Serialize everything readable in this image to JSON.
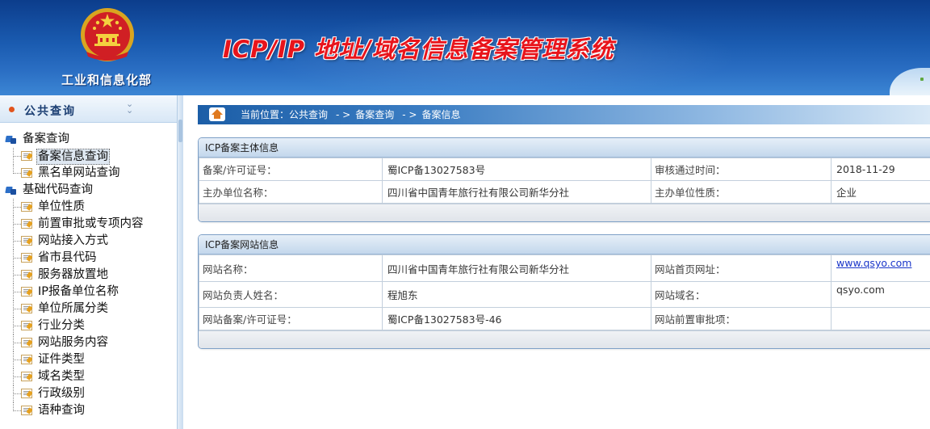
{
  "header": {
    "ministry": "工业和信息化部",
    "system_title": "ICP/IP 地址/域名信息备案管理系统"
  },
  "sidebar": {
    "title": "公共查询",
    "groups": [
      {
        "label": "备案查询",
        "items": [
          {
            "label": "备案信息查询",
            "selected": true
          },
          {
            "label": "黑名单网站查询"
          }
        ]
      },
      {
        "label": "基础代码查询",
        "items": [
          {
            "label": "单位性质"
          },
          {
            "label": "前置审批或专项内容"
          },
          {
            "label": "网站接入方式"
          },
          {
            "label": "省市县代码"
          },
          {
            "label": "服务器放置地"
          },
          {
            "label": "IP报备单位名称"
          },
          {
            "label": "单位所属分类"
          },
          {
            "label": "行业分类"
          },
          {
            "label": "网站服务内容"
          },
          {
            "label": "证件类型"
          },
          {
            "label": "域名类型"
          },
          {
            "label": "行政级别"
          },
          {
            "label": "语种查询"
          }
        ]
      }
    ]
  },
  "breadcrumb": {
    "prefix": "当前位置：",
    "items": [
      "公共查询",
      "备案查询",
      "备案信息"
    ],
    "separator": "- >"
  },
  "subject": {
    "title": "ICP备案主体信息",
    "license_label": "备案/许可证号：",
    "license_value": "蜀ICP备13027583号",
    "approve_label": "审核通过时间：",
    "approve_value": "2018-11-29",
    "org_name_label": "主办单位名称：",
    "org_name_value": "四川省中国青年旅行社有限公司新华分社",
    "org_type_label": "主办单位性质：",
    "org_type_value": "企业"
  },
  "website": {
    "title": "ICP备案网站信息",
    "name_label": "网站名称：",
    "name_value": "四川省中国青年旅行社有限公司新华分社",
    "home_label": "网站首页网址：",
    "home_value": "www.qsyo.com",
    "owner_label": "网站负责人姓名：",
    "owner_value": "程旭东",
    "domain_label": "网站域名：",
    "domain_value": "qsyo.com",
    "license_label": "网站备案/许可证号：",
    "license_value": "蜀ICP备13027583号-46",
    "preapproval_label": "网站前置审批项：",
    "preapproval_value": ""
  },
  "colors": {
    "header_blue": "#1a5bb0",
    "title_red": "#e8141b",
    "link_blue": "#1a36c9",
    "panel_border": "#7d9fc6"
  }
}
